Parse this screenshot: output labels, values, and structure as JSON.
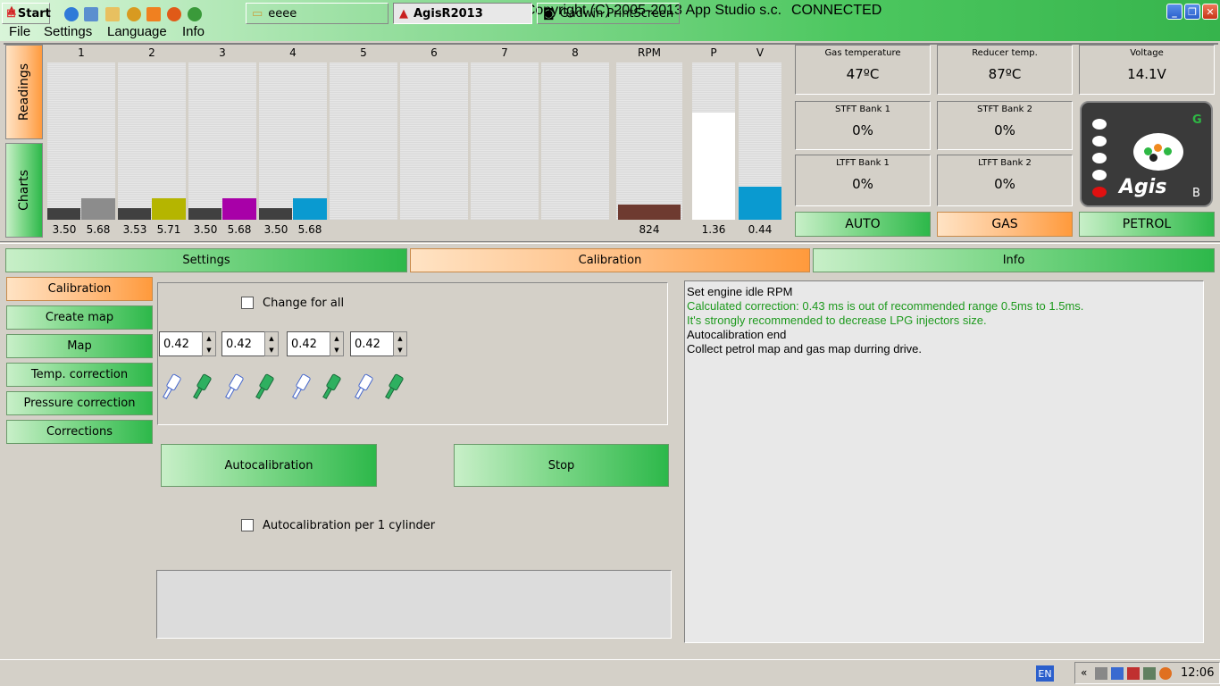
{
  "window": {
    "title": "Agis R2013 - Copyright (C) 2005-2013 App Studio s.c.",
    "status": "CONNECTED"
  },
  "menu": [
    "File",
    "Settings",
    "Language",
    "Info"
  ],
  "side_tabs": {
    "readings": "Readings",
    "charts": "Charts"
  },
  "cylinders": {
    "labels": [
      "1",
      "2",
      "3",
      "4",
      "5",
      "6",
      "7",
      "8"
    ],
    "values": [
      [
        "3.50",
        "5.68"
      ],
      [
        "3.53",
        "5.71"
      ],
      [
        "3.50",
        "5.68"
      ],
      [
        "3.50",
        "5.68"
      ]
    ],
    "colors": [
      "#8c8c8c",
      "#b5b500",
      "#a800a8",
      "#0a9ad0"
    ]
  },
  "rpm": {
    "label": "RPM",
    "value": "824",
    "color": "#6e3a30"
  },
  "pressure": {
    "label": "P",
    "value": "1.36",
    "level": 0.68
  },
  "vacuum": {
    "label": "V",
    "value": "0.44",
    "level": 0.21,
    "color": "#0a9ad0"
  },
  "readouts": {
    "gas_temp": {
      "title": "Gas temperature",
      "value": "47ºC"
    },
    "reducer_temp": {
      "title": "Reducer temp.",
      "value": "87ºC"
    },
    "voltage": {
      "title": "Voltage",
      "value": "14.1V"
    },
    "stft1": {
      "title": "STFT Bank 1",
      "value": "0%"
    },
    "stft2": {
      "title": "STFT Bank 2",
      "value": "0%"
    },
    "ltft1": {
      "title": "LTFT Bank 1",
      "value": "0%"
    },
    "ltft2": {
      "title": "LTFT Bank 2",
      "value": "0%"
    }
  },
  "mode_buttons": {
    "auto": "AUTO",
    "gas": "GAS",
    "petrol": "PETROL"
  },
  "logo": {
    "text": "Agis",
    "g": "G",
    "b": "B"
  },
  "main_tabs": [
    "Settings",
    "Calibration",
    "Info"
  ],
  "side_menu": [
    "Calibration",
    "Create map",
    "Map",
    "Temp. correction",
    "Pressure correction",
    "Corrections"
  ],
  "calibration": {
    "change_for_all": "Change for all",
    "spin_values": [
      "0.42",
      "0.42",
      "0.42",
      "0.42"
    ],
    "autocalibration": "Autocalibration",
    "stop": "Stop",
    "per_cylinder": "Autocalibration per 1 cylinder"
  },
  "messages": [
    {
      "text": "Set engine idle RPM",
      "green": false
    },
    {
      "text": "Calculated correction: 0.43 ms is out of recommended range 0.5ms to 1.5ms.",
      "green": true
    },
    {
      "text": "It's strongly recommended to decrease LPG injectors size.",
      "green": true
    },
    {
      "text": "Autocalibration end",
      "green": false
    },
    {
      "text": "Collect petrol map and gas map durring drive.",
      "green": false
    }
  ],
  "taskbar": {
    "start": "Start",
    "items": [
      "eeee",
      "AgisR2013",
      "Gadwin PrintScreen"
    ],
    "lang": "EN",
    "clock": "12:06"
  }
}
